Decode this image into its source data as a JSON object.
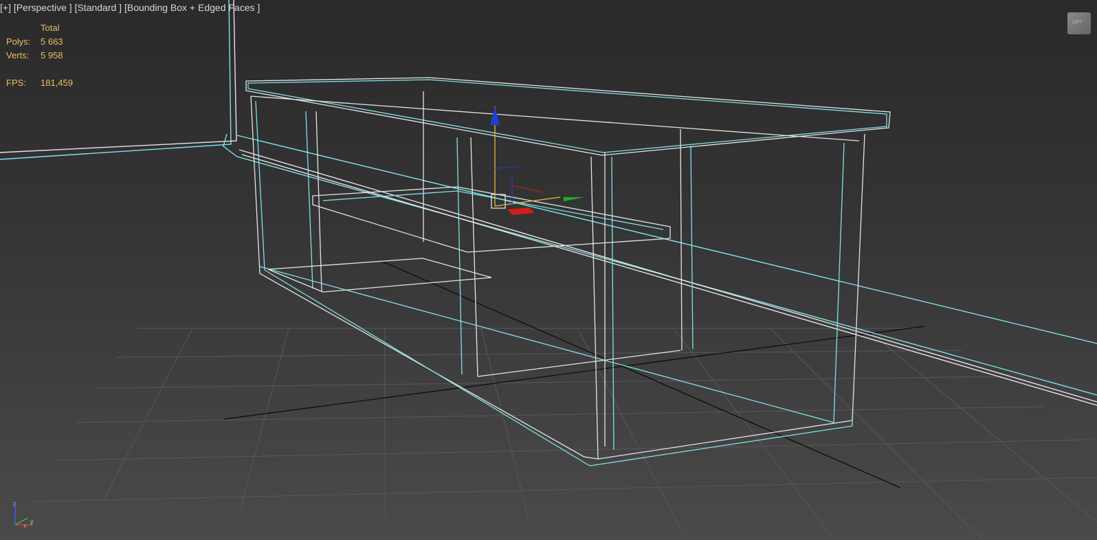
{
  "viewport": {
    "label_parts": [
      "[+]",
      "[Perspective ]",
      "[Standard ]",
      "[Bounding Box + Edged Faces ]"
    ],
    "stats": {
      "header": "Total",
      "rows": [
        {
          "label": "Polys:",
          "value": "5 663"
        },
        {
          "label": "Verts:",
          "value": "5 958"
        }
      ],
      "fps_label": "FPS:",
      "fps_value": "181,459"
    },
    "viewcube_face": "LEFT",
    "axis_labels": {
      "z": "z",
      "y": "y",
      "x": "x"
    }
  },
  "colors": {
    "selection_wire": "#7fe3ea",
    "object_wire": "#e6e6e6",
    "gizmo_x": "#d21b1b",
    "gizmo_y": "#1fae2c",
    "gizmo_z": "#1e3fd0",
    "stats_text": "#e8c060"
  }
}
